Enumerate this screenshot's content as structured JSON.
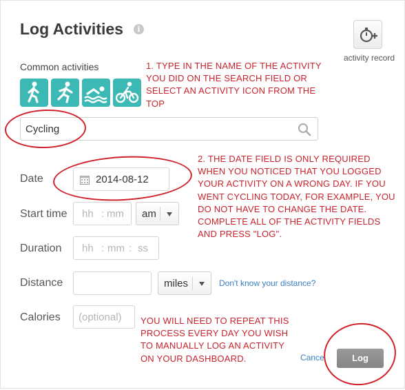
{
  "header": {
    "title": "Log Activities",
    "info_icon": "info-icon",
    "info_glyph": "i",
    "activity_record_label": "activity record",
    "activity_record_icon": "stopwatch-plus-icon"
  },
  "common": {
    "label": "Common activities",
    "icons": [
      "walking-icon",
      "running-icon",
      "swimming-icon",
      "cycling-icon"
    ],
    "icon_color": "#3cb9b4"
  },
  "search": {
    "value": "Cycling",
    "icon": "search-icon"
  },
  "form": {
    "date": {
      "label": "Date",
      "value": "2014-08-12",
      "icon": "calendar-icon"
    },
    "start_time": {
      "label": "Start time",
      "hh_placeholder": "hh",
      "mm_placeholder": "mm",
      "ampm_value": "am"
    },
    "duration": {
      "label": "Duration",
      "hh_placeholder": "hh",
      "mm_placeholder": "mm",
      "ss_placeholder": "ss"
    },
    "distance": {
      "label": "Distance",
      "unit_value": "miles",
      "help_link": "Don't know your distance?"
    },
    "calories": {
      "label": "Calories",
      "placeholder": "(optional)"
    }
  },
  "actions": {
    "cancel_label": "Cance",
    "log_label": "Log"
  },
  "annotations": {
    "note1": [
      "1. TYPE IN THE NAME OF THE ACTIVITY",
      "YOU DID ON THE SEARCH FIELD OR",
      "SELECT AN ACTIVITY ICON FROM THE",
      "TOP"
    ],
    "note2": [
      "2. THE DATE FIELD IS ONLY REQUIRED",
      "WHEN YOU NOTICED THAT YOU LOGGED",
      "YOUR ACTIVITY ON A WRONG DAY. IF YOU",
      "WENT CYCLING TODAY, FOR EXAMPLE, YOU",
      "DO NOT HAVE TO CHANGE THE DATE.",
      "COMPLETE ALL OF THE ACTIVITY FIELDS",
      "AND PRESS \"LOG\"."
    ],
    "note3": [
      "YOU WILL NEED TO REPEAT THIS",
      "PROCESS EVERY DAY YOU WISH",
      "TO MANUALLY LOG AN ACTIVITY",
      "ON YOUR DASHBOARD."
    ],
    "color": "#c8232c"
  }
}
